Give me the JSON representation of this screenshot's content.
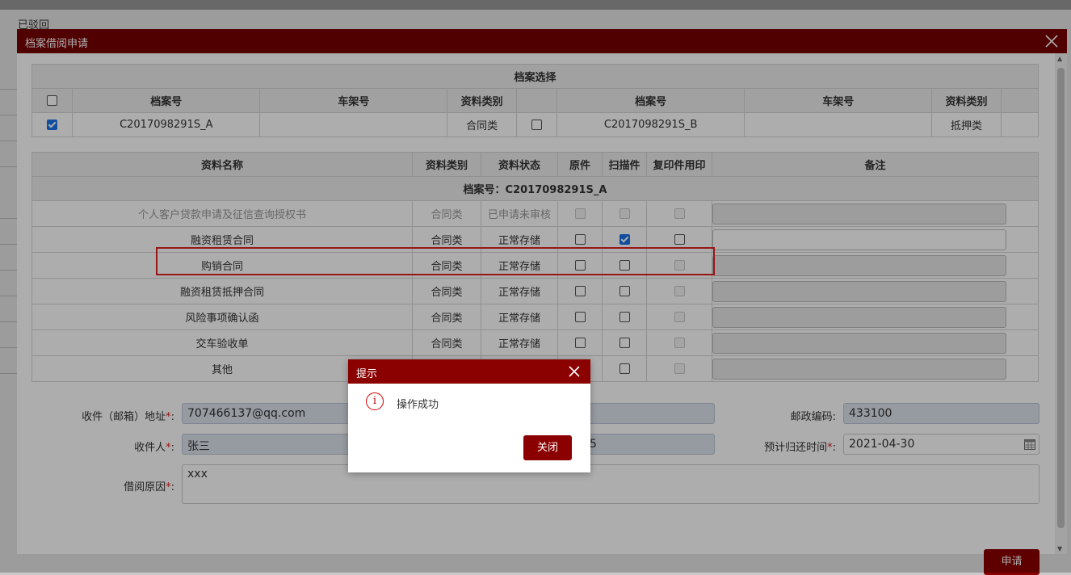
{
  "background": {
    "status_text": "已驳回"
  },
  "dialog": {
    "title": "档案借阅申请",
    "archive_selection": {
      "caption": "档案选择",
      "headers": [
        "档案号",
        "车架号",
        "资料类别"
      ],
      "left": {
        "checked": true,
        "archive_no": "C2017098291S_A",
        "vin": "",
        "category": "合同类"
      },
      "right": {
        "checked": false,
        "archive_no": "C2017098291S_B",
        "vin": "",
        "category": "抵押类"
      }
    },
    "materials": {
      "headers": {
        "name": "资料名称",
        "category": "资料类别",
        "status": "资料状态",
        "original": "原件",
        "scan": "扫描件",
        "copy": "复印件用印",
        "remark": "备注"
      },
      "group_label": "档案号：C2017098291S_A",
      "rows": [
        {
          "name": "个人客户贷款申请及征信查询授权书",
          "category": "合同类",
          "status": "已申请未审核",
          "disabled": true,
          "original": false,
          "scan": false,
          "copy": false
        },
        {
          "name": "融资租赁合同",
          "category": "合同类",
          "status": "正常存储",
          "disabled": false,
          "original": false,
          "scan": true,
          "copy": false
        },
        {
          "name": "购销合同",
          "category": "合同类",
          "status": "正常存储",
          "disabled": false,
          "original": false,
          "scan": false,
          "copy": false
        },
        {
          "name": "融资租赁抵押合同",
          "category": "合同类",
          "status": "正常存储",
          "disabled": false,
          "original": false,
          "scan": false,
          "copy": false
        },
        {
          "name": "风险事项确认函",
          "category": "合同类",
          "status": "正常存储",
          "disabled": false,
          "original": false,
          "scan": false,
          "copy": false
        },
        {
          "name": "交车验收单",
          "category": "合同类",
          "status": "正常存储",
          "disabled": false,
          "original": false,
          "scan": false,
          "copy": false
        },
        {
          "name": "其他",
          "category": "",
          "status": "",
          "disabled": false,
          "original": false,
          "scan": false,
          "copy": false
        }
      ]
    },
    "form": {
      "email_label": "收件（邮箱）地址",
      "email_value": "707466137@qq.com",
      "postcode_label": "邮政编码:",
      "postcode_value": "433100",
      "recipient_label": "收件人",
      "recipient_value": "张三",
      "phone_partial": "5",
      "return_label": "预计归还时间",
      "return_value": "2021-04-30",
      "reason_label": "借阅原因",
      "reason_value": "xxx",
      "required_mark": "*",
      "colon": ":"
    },
    "apply_button": "申请"
  },
  "toast": {
    "title": "提示",
    "icon_glyph": "i",
    "message": "操作成功",
    "close_button": "关闭"
  },
  "colors": {
    "header_red": "#770000",
    "button_red": "#8b0000",
    "highlight": "#e02020",
    "checkbox_blue": "#1a73e8"
  }
}
